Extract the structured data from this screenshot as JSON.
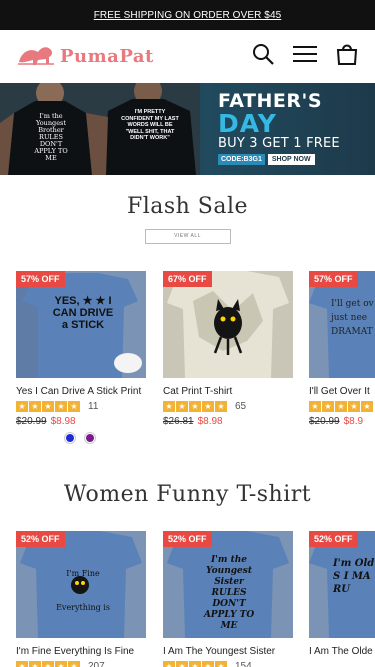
{
  "topbar": {
    "text": "FREE SHIPPING ON ORDER OVER $45"
  },
  "header": {
    "logo_text": "PumaPat",
    "icons": [
      "search-icon",
      "menu-icon",
      "cart-icon"
    ]
  },
  "banner": {
    "shirt_left_text": "I'm the Youngest Brother RULES DON'T APPLY TO ME",
    "shirt_right_text": "I'M PRETTY CONFIDENT MY LAST WORDS WILL BE \"WELL SHIT, THAT DIDN'T WORK\"",
    "line1": "FATHER'S",
    "line2": "DAY",
    "line3": "BUY 3 GET 1 FREE",
    "code": "CODE:B3G1",
    "shop": "SHOP NOW"
  },
  "flash_sale": {
    "title": "Flash Sale",
    "view_all": "VIEW ALL",
    "products": [
      {
        "badge": "57% OFF",
        "name": "Yes I Can Drive A Stick Print",
        "reviews": "11",
        "old": "$20.99",
        "new": "$8.98",
        "shirt_text": "YES, ★ ★ I CAN DRIVE a STICK",
        "swatches": [
          "#1e2bd8",
          "#7a1a8c"
        ]
      },
      {
        "badge": "67% OFF",
        "name": "Cat Print T-shirt",
        "reviews": "65",
        "old": "$26.81",
        "new": "$8.98"
      },
      {
        "badge": "57% OFF",
        "name": "I'll Get Over It",
        "reviews": "",
        "old": "$20.99",
        "new": "$8.9",
        "shirt_text": "I'll get ov I just nee DRAMAT"
      }
    ]
  },
  "women": {
    "title": "Women Funny T-shirt",
    "products": [
      {
        "badge": "52% OFF",
        "name": "I'm Fine Everything Is Fine",
        "reviews": "207",
        "shirt_text": "I'm Fine Everything is Fine"
      },
      {
        "badge": "52% OFF",
        "name": "I Am The Youngest Sister",
        "reviews": "154",
        "shirt_text": "I'm the Youngest Sister RULES DON'T APPLY TO ME"
      },
      {
        "badge": "52% OFF",
        "name": "I Am The Olde",
        "reviews": "",
        "shirt_text": "I'm Old S I MA RU"
      }
    ]
  }
}
